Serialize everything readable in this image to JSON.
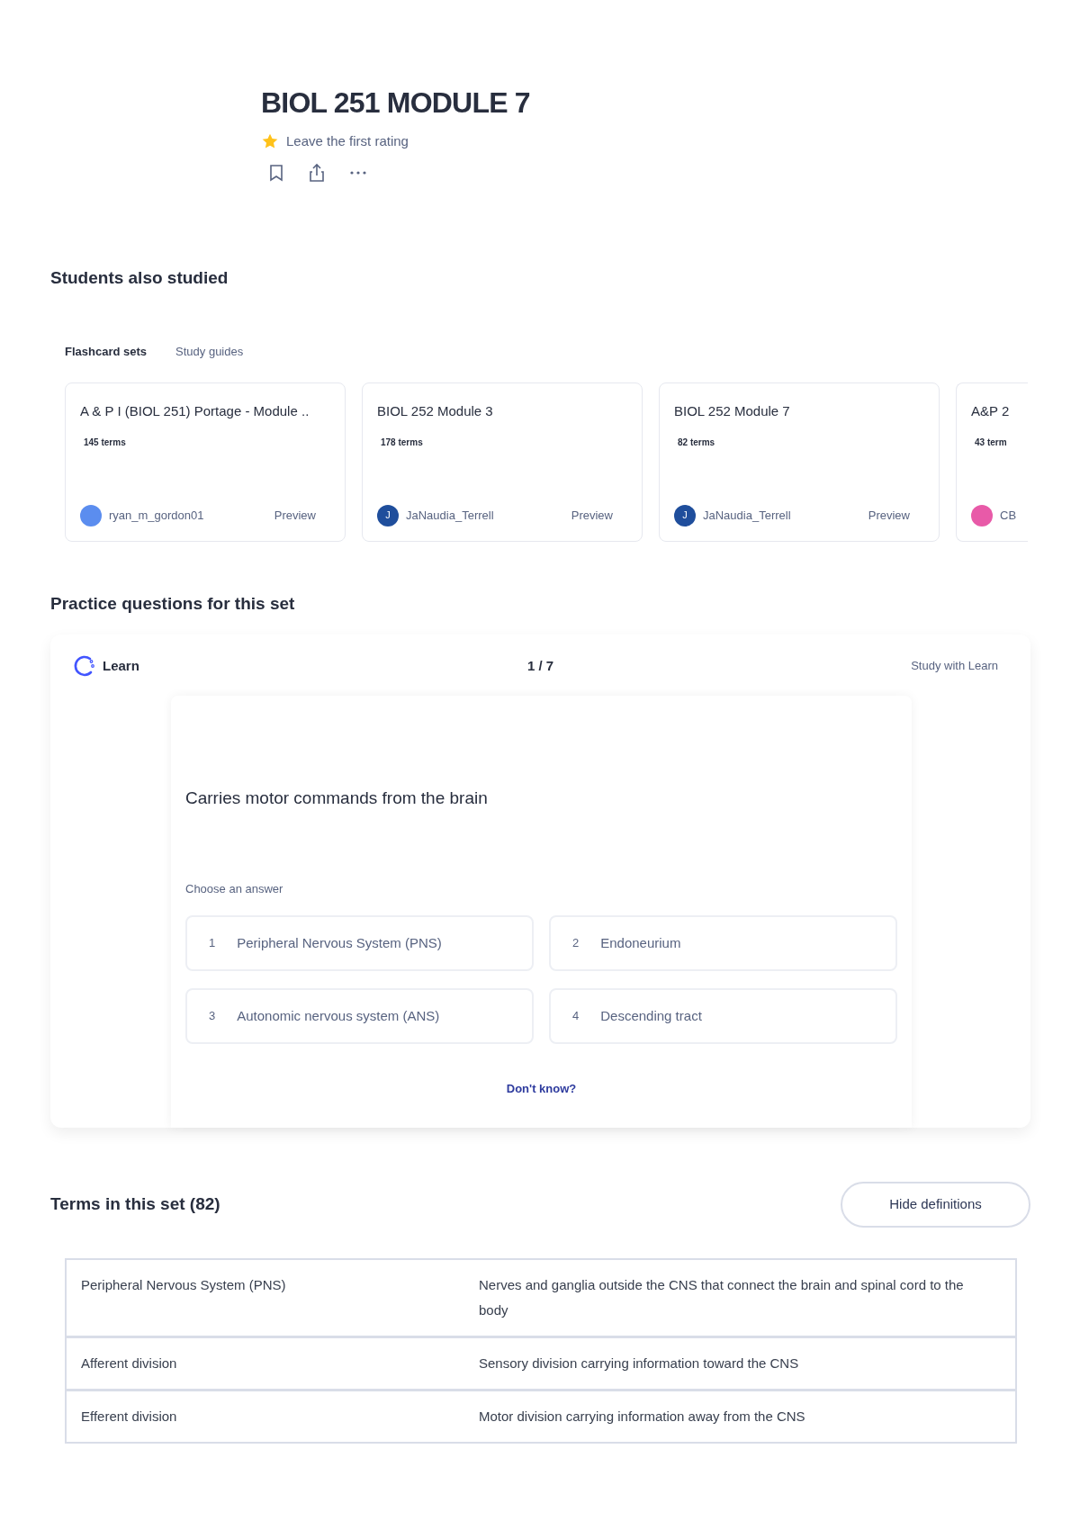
{
  "set": {
    "title": "BIOL 251 MODULE 7",
    "rating_prompt": "Leave the first rating"
  },
  "also_studied": {
    "heading": "Students also studied",
    "tabs": [
      {
        "label": "Flashcard sets",
        "selected": true
      },
      {
        "label": "Study guides",
        "selected": false
      }
    ],
    "cards": [
      {
        "title": "A & P I (BIOL 251) Portage - Module ..",
        "terms": "145 terms",
        "author": "ryan_m_gordon01",
        "color": "#5b8def",
        "preview": "Preview"
      },
      {
        "title": "BIOL 252 Module 3",
        "terms": "178 terms",
        "author": "JaNaudia_Terrell",
        "avatar_initial": "J",
        "color": "#1f4e9c",
        "preview": "Preview"
      },
      {
        "title": "BIOL 252 Module 7",
        "terms": "82 terms",
        "author": "JaNaudia_Terrell",
        "avatar_initial": "J",
        "color": "#1f4e9c",
        "preview": "Preview"
      },
      {
        "title": "A&P 2",
        "terms": "43 term",
        "author": "CB",
        "color": "#e85aa8"
      }
    ]
  },
  "practice": {
    "heading": "Practice questions for this set",
    "mode": "Learn",
    "progress": "1 / 7",
    "study_link": "Study with Learn",
    "question": "Carries motor commands from the brain",
    "prompt": "Choose an answer",
    "answers": [
      {
        "number": "1",
        "text": "Peripheral Nervous System (PNS)"
      },
      {
        "number": "2",
        "text": "Endoneurium"
      },
      {
        "number": "3",
        "text": "Autonomic nervous system (ANS)"
      },
      {
        "number": "4",
        "text": "Descending tract"
      }
    ],
    "dont_know": "Don't know?"
  },
  "terms": {
    "heading": "Terms in this set (82)",
    "toggle_button": "Hide definitions",
    "rows": [
      {
        "term": "Peripheral Nervous System (PNS)",
        "definition": "Nerves and ganglia outside the CNS that connect the brain and spinal cord to the body"
      },
      {
        "term": "Afferent division",
        "definition": "Sensory division carrying information toward the CNS"
      },
      {
        "term": "Efferent division",
        "definition": "Motor division carrying information away from the CNS"
      }
    ]
  }
}
